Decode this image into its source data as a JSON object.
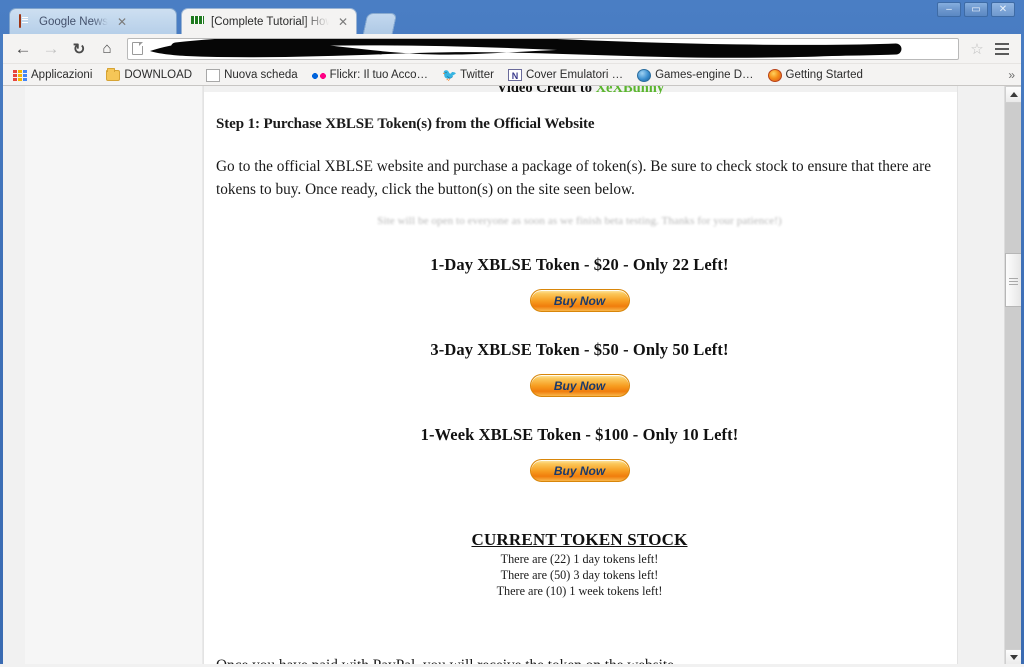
{
  "window": {
    "controls": {
      "minimize": "–",
      "maximize": "▭",
      "close": "✕"
    }
  },
  "tabs": [
    {
      "title": "Google News",
      "favicon": "news-icon",
      "close": "✕",
      "active": false
    },
    {
      "title": "[Complete Tutorial] How t",
      "favicon": "green-barcode-icon",
      "close": "✕",
      "active": true
    }
  ],
  "toolbar": {
    "back": "←",
    "forward": "→",
    "reload": "↻",
    "home": "⌂",
    "omnibox_value": "",
    "omnibox_placeholder": "",
    "bookmark_star": "☆",
    "menu": "menu-icon"
  },
  "bookmarks": {
    "items": [
      {
        "label": "Applicazioni",
        "icon": "apps-grid-icon"
      },
      {
        "label": "DOWNLOAD",
        "icon": "folder-icon"
      },
      {
        "label": "Nuova scheda",
        "icon": "page-icon"
      },
      {
        "label": "Flickr: Il tuo Acco…",
        "icon": "flickr-dots-icon"
      },
      {
        "label": "Twitter",
        "icon": "twitter-bird-icon"
      },
      {
        "label": "Cover Emulatori …",
        "icon": "cover-icon"
      },
      {
        "label": "Games-engine D…",
        "icon": "globe-icon"
      },
      {
        "label": "Getting Started",
        "icon": "firefox-icon"
      }
    ],
    "overflow": "»"
  },
  "page": {
    "credit": {
      "prefix": "Video Credit to ",
      "link": "XeXBunny"
    },
    "step_heading": "Step 1: Purchase XBLSE Token(s) from the Official Website",
    "intro_paragraph": "Go to the official XBLSE website and purchase a package of token(s). Be sure to check stock to ensure that there are tokens to buy. Once ready, click the button(s) on the site seen below.",
    "ghost_notice": "Site will be open to everyone as soon as we finish beta testing. Thanks for your patience!)",
    "offers": [
      {
        "title": "1-Day XBLSE Token - $20 - Only 22 Left!",
        "button": "Buy Now"
      },
      {
        "title": "3-Day XBLSE Token - $50 - Only 50 Left!",
        "button": "Buy Now"
      },
      {
        "title": "1-Week XBLSE Token - $100 - Only 10 Left!",
        "button": "Buy Now"
      }
    ],
    "stock": {
      "heading": "CURRENT TOKEN STOCK",
      "lines": [
        "There are (22) 1 day tokens left!",
        "There are (50) 3 day tokens left!",
        "There are (10) 1 week tokens left!"
      ]
    },
    "closing_paragraph": "Once you have paid with PayPal, you will receive the token on the website."
  },
  "colors": {
    "window_chrome": "#3f71b8",
    "tab_active_bg": "#f4f3f2",
    "link_green": "#5ab52e",
    "buy_button_orange": "#f79d20",
    "buy_button_text": "#1b3a6b",
    "page_background": "#f1f1f1",
    "content_background": "#ffffff"
  }
}
